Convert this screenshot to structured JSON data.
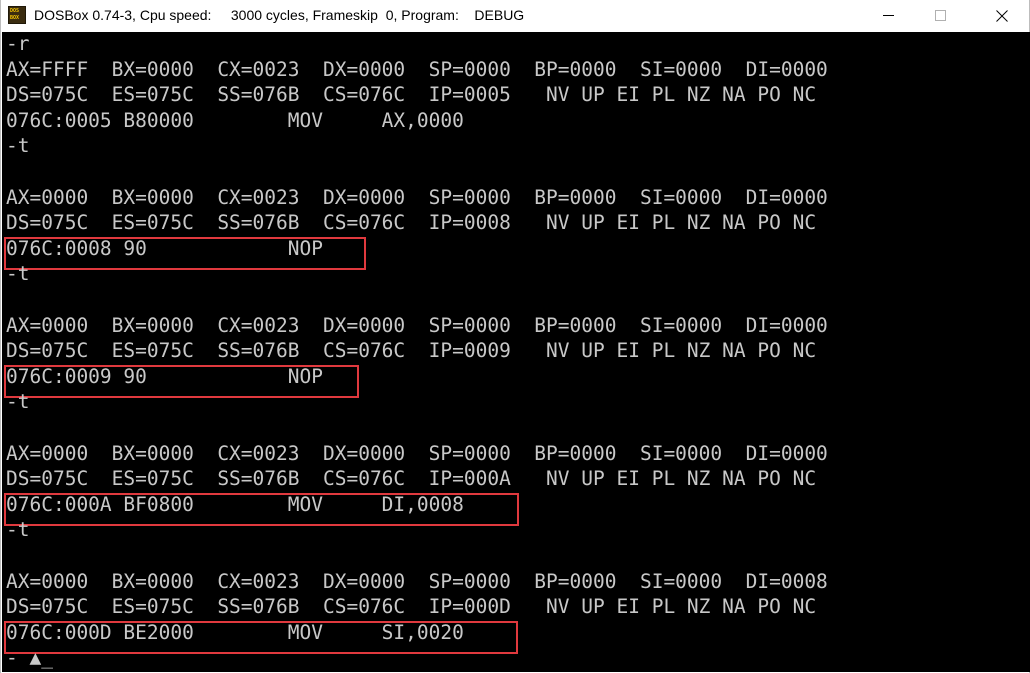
{
  "window": {
    "title": "DOSBox 0.74-3, Cpu speed:     3000 cycles, Frameskip  0, Program:    DEBUG",
    "icon_label_top": "DOS",
    "icon_label_bottom": "BOX",
    "icon": "dosbox-icon",
    "controls": [
      "minimize-icon",
      "maximize-icon",
      "close-icon"
    ]
  },
  "console": {
    "text_color": "#c8c8c8",
    "background": "#000000",
    "highlight_color": "#e0393e",
    "lines": [
      "-r",
      "AX=FFFF  BX=0000  CX=0023  DX=0000  SP=0000  BP=0000  SI=0000  DI=0000",
      "DS=075C  ES=075C  SS=076B  CS=076C  IP=0005   NV UP EI PL NZ NA PO NC",
      "076C:0005 B80000        MOV     AX,0000",
      "-t",
      "",
      "AX=0000  BX=0000  CX=0023  DX=0000  SP=0000  BP=0000  SI=0000  DI=0000",
      "DS=075C  ES=075C  SS=076B  CS=076C  IP=0008   NV UP EI PL NZ NA PO NC",
      "076C:0008 90            NOP",
      "-t",
      "",
      "AX=0000  BX=0000  CX=0023  DX=0000  SP=0000  BP=0000  SI=0000  DI=0000",
      "DS=075C  ES=075C  SS=076B  CS=076C  IP=0009   NV UP EI PL NZ NA PO NC",
      "076C:0009 90            NOP",
      "-t",
      "",
      "AX=0000  BX=0000  CX=0023  DX=0000  SP=0000  BP=0000  SI=0000  DI=0000",
      "DS=075C  ES=075C  SS=076B  CS=076C  IP=000A   NV UP EI PL NZ NA PO NC",
      "076C:000A BF0800        MOV     DI,0008",
      "-t",
      "",
      "AX=0000  BX=0000  CX=0023  DX=0000  SP=0000  BP=0000  SI=0000  DI=0008",
      "DS=075C  ES=075C  SS=076B  CS=076C  IP=000D   NV UP EI PL NZ NA PO NC",
      "076C:000D BE2000        MOV     SI,0020",
      "- ▲_"
    ],
    "highlighted_lines": [
      8,
      13,
      18,
      23
    ]
  }
}
